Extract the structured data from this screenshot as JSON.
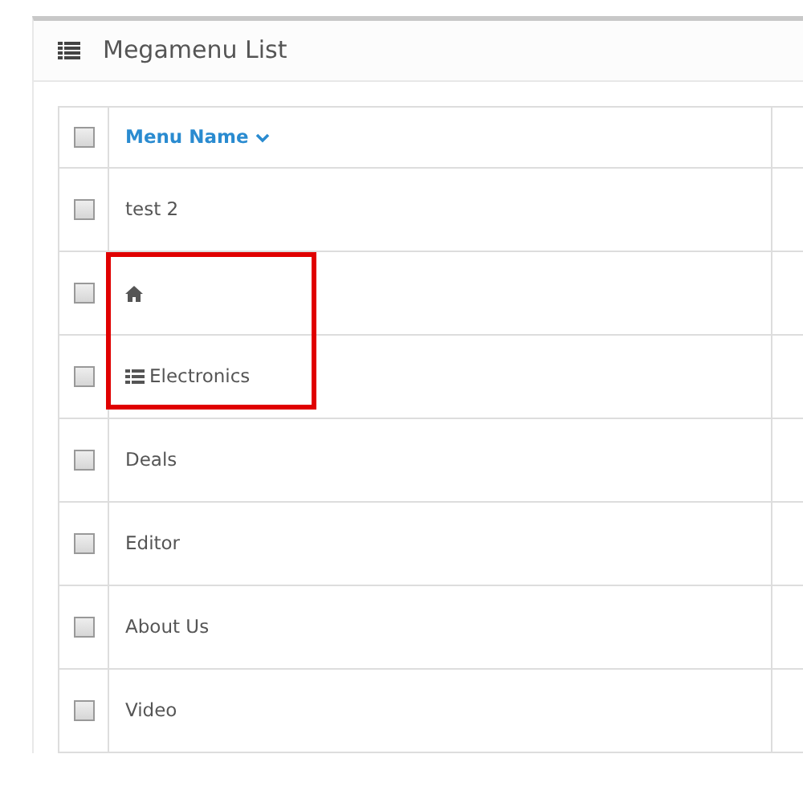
{
  "panel": {
    "title": "Megamenu List"
  },
  "table": {
    "select_all": {
      "checked": false
    },
    "columns": [
      {
        "label": "Menu Name"
      }
    ],
    "rows": [
      {
        "name": "test 2",
        "kind": "text",
        "checked": false,
        "highlighted": false
      },
      {
        "name": "",
        "kind": "home",
        "checked": false,
        "highlighted": true
      },
      {
        "name": "Electronics",
        "kind": "menu",
        "checked": false,
        "highlighted": true
      },
      {
        "name": "Deals",
        "kind": "text",
        "checked": false,
        "highlighted": false
      },
      {
        "name": "Editor",
        "kind": "text",
        "checked": false,
        "highlighted": false
      },
      {
        "name": "About Us",
        "kind": "text",
        "checked": false,
        "highlighted": false
      },
      {
        "name": "Video",
        "kind": "text",
        "checked": false,
        "highlighted": false
      }
    ]
  }
}
